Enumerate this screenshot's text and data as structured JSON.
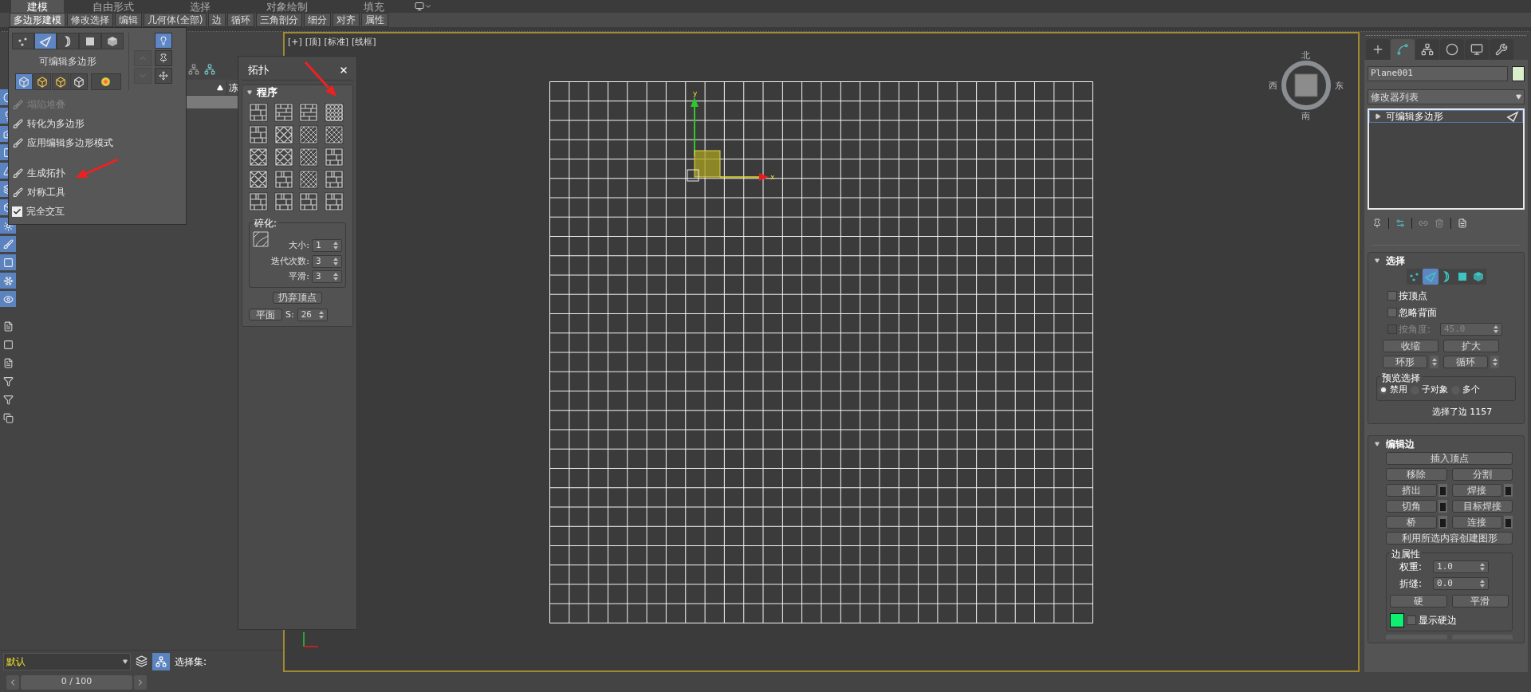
{
  "ribbon": {
    "tabs": [
      {
        "label": "建模",
        "selected": true
      },
      {
        "label": "自由形式",
        "selected": false
      },
      {
        "label": "选择",
        "selected": false
      },
      {
        "label": "对象绘制",
        "selected": false
      },
      {
        "label": "填充",
        "selected": false
      }
    ],
    "panels": [
      {
        "label": "多边形建模",
        "selected": true
      },
      {
        "label": "修改选择",
        "selected": false
      },
      {
        "label": "编辑",
        "selected": false
      },
      {
        "label": "几何体(全部)",
        "selected": false
      },
      {
        "label": "边",
        "selected": false
      },
      {
        "label": "循环",
        "selected": false
      },
      {
        "label": "三角剖分",
        "selected": false
      },
      {
        "label": "细分",
        "selected": false
      },
      {
        "label": "对齐",
        "selected": false
      },
      {
        "label": "属性",
        "selected": false
      }
    ]
  },
  "popup": {
    "levels": [
      {
        "selected": false
      },
      {
        "selected": true
      },
      {
        "selected": false
      },
      {
        "selected": false
      },
      {
        "selected": false
      }
    ],
    "title": "可编辑多边形",
    "modes": [
      {
        "selected": true
      },
      {
        "selected": false
      },
      {
        "selected": false
      },
      {
        "selected": false
      },
      {
        "selected": false
      }
    ],
    "side_buttons": [
      {
        "selected": true,
        "disabled": false
      },
      {
        "selected": false,
        "disabled": false
      },
      {
        "selected": false,
        "disabled": false
      }
    ],
    "groups": [
      [
        {
          "label": "塌陷堆叠",
          "kind": "command",
          "disabled": true
        },
        {
          "label": "转化为多边形",
          "kind": "command",
          "disabled": false
        },
        {
          "label": "应用编辑多边形模式",
          "kind": "command",
          "disabled": false
        }
      ],
      [
        {
          "label": "生成拓扑",
          "kind": "command",
          "disabled": false
        },
        {
          "label": "对称工具",
          "kind": "command",
          "disabled": false
        },
        {
          "label": "完全交互",
          "kind": "checkbox",
          "disabled": false,
          "checked": true
        }
      ]
    ]
  },
  "explorer": {
    "freeze_column": "冻"
  },
  "viewport": {
    "labels": [
      "[+]",
      "[顶]",
      "[标准]",
      "[线框]"
    ],
    "viewcube": {
      "north": "北",
      "west": "西",
      "east": "东",
      "south": "南"
    },
    "gizmo": {
      "x_label": "x",
      "y_label": "y"
    }
  },
  "topology": {
    "title": "拓扑",
    "section": "程序",
    "relax": {
      "title": "碎化:",
      "fields": [
        {
          "label": "大小:",
          "value": "1"
        },
        {
          "label": "迭代次数:",
          "value": "3"
        },
        {
          "label": "平滑:",
          "value": "3"
        }
      ]
    },
    "discard_button": "扔弃顶点",
    "plane_button": "平面",
    "s_label": "S:",
    "s_value": "26"
  },
  "command_panel": {
    "tabs": [
      {
        "selected": false
      },
      {
        "selected": true
      },
      {
        "selected": false
      },
      {
        "selected": false
      },
      {
        "selected": false
      },
      {
        "selected": false
      }
    ],
    "object_name": "Plane001",
    "modifier_list": "修改器列表",
    "stack": [
      {
        "label": "可编辑多边形",
        "selected": true
      }
    ],
    "selection": {
      "title": "选择",
      "levels": [
        {
          "selected": false
        },
        {
          "selected": true
        },
        {
          "selected": false
        },
        {
          "selected": false
        },
        {
          "selected": false
        }
      ],
      "checks": [
        {
          "label": "按顶点",
          "checked": false,
          "disabled": false
        },
        {
          "label": "忽略背面",
          "checked": false,
          "disabled": false
        }
      ],
      "angle": {
        "label": "按角度:",
        "checked": false,
        "disabled": true,
        "value": "45.0"
      },
      "buttons": [
        "收缩",
        "扩大"
      ],
      "spin_buttons": [
        "环形",
        "循环"
      ],
      "preview": {
        "title": "预览选择",
        "options": [
          {
            "label": "禁用",
            "selected": true
          },
          {
            "label": "子对象",
            "selected": false
          },
          {
            "label": "多个",
            "selected": false
          }
        ]
      },
      "status": "选择了边 1157"
    },
    "edit_edges": {
      "title": "编辑边",
      "buttons": [
        {
          "label": "插入顶点",
          "kind": "wide",
          "settings": false
        },
        {
          "label": "移除",
          "kind": "half",
          "settings": false
        },
        {
          "label": "分割",
          "kind": "half",
          "settings": false
        },
        {
          "label": "挤出",
          "kind": "half",
          "settings": true
        },
        {
          "label": "焊接",
          "kind": "half",
          "settings": true
        },
        {
          "label": "切角",
          "kind": "half",
          "settings": true
        },
        {
          "label": "目标焊接",
          "kind": "half",
          "settings": false
        },
        {
          "label": "桥",
          "kind": "half",
          "settings": true
        },
        {
          "label": "连接",
          "kind": "half",
          "settings": true
        },
        {
          "label": "利用所选内容创建图形",
          "kind": "wide",
          "settings": false
        }
      ],
      "props": {
        "title": "边属性",
        "fields": [
          {
            "label": "权重:",
            "value": "1.0"
          },
          {
            "label": "折缝:",
            "value": "0.0"
          }
        ],
        "buttons": [
          "硬",
          "平滑"
        ],
        "show_hard": {
          "label": "显示硬边",
          "checked": false
        }
      }
    }
  },
  "bottom": {
    "layer": "默认",
    "selection_set": "选择集:",
    "time": "0 / 100"
  }
}
